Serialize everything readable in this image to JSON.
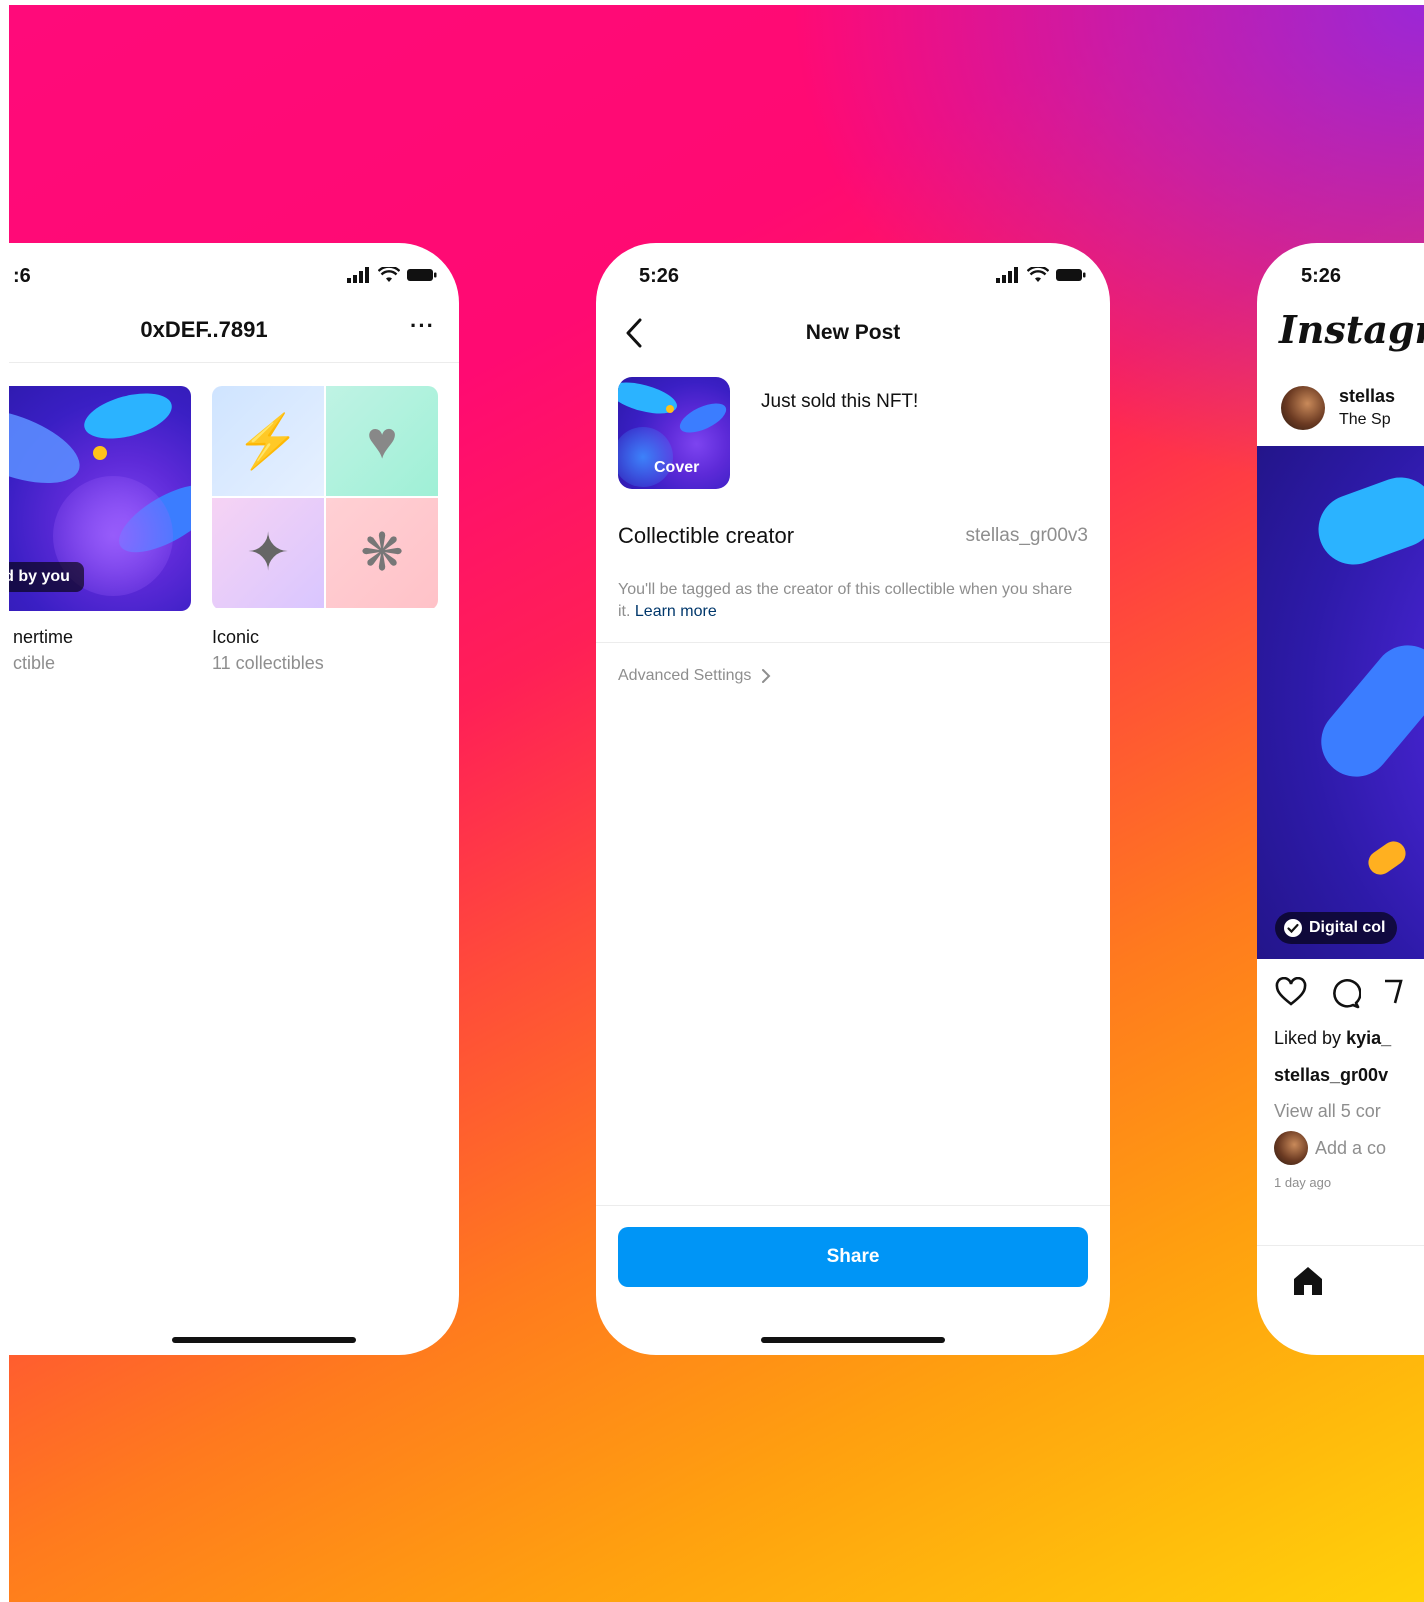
{
  "left": {
    "status_time": ":6",
    "title": "0xDEF..7891",
    "menu_label": "···",
    "items": [
      {
        "badge": "ated by you",
        "name": "nertime",
        "subtitle": "ctible"
      },
      {
        "name": "Iconic",
        "subtitle": "11 collectibles"
      }
    ]
  },
  "mid": {
    "status_time": "5:26",
    "title": "New Post",
    "caption": "Just sold this NFT!",
    "cover_label": "Cover",
    "creator_label": "Collectible creator",
    "creator_value": "stellas_gr00v3",
    "tag_note": "You'll be tagged as the creator of this collectible when you share it.",
    "learn_more": "Learn more",
    "advanced_settings": "Advanced Settings",
    "share_button": "Share"
  },
  "right": {
    "status_time": "5:26",
    "logo": "Instagr",
    "username": "stellas",
    "location": "The Sp",
    "badge": "Digital col",
    "liked_by_prefix": "Liked by",
    "liked_by_user": "kyia_",
    "caption_user": "stellas_gr00v",
    "view_comments": "View all 5 cor",
    "add_comment": "Add a co",
    "time_ago": "1 day ago"
  },
  "colors": {
    "accent_blue": "#0095f6",
    "link_blue": "#00376b",
    "text_primary": "#111111",
    "text_secondary": "#8e8e8e"
  }
}
